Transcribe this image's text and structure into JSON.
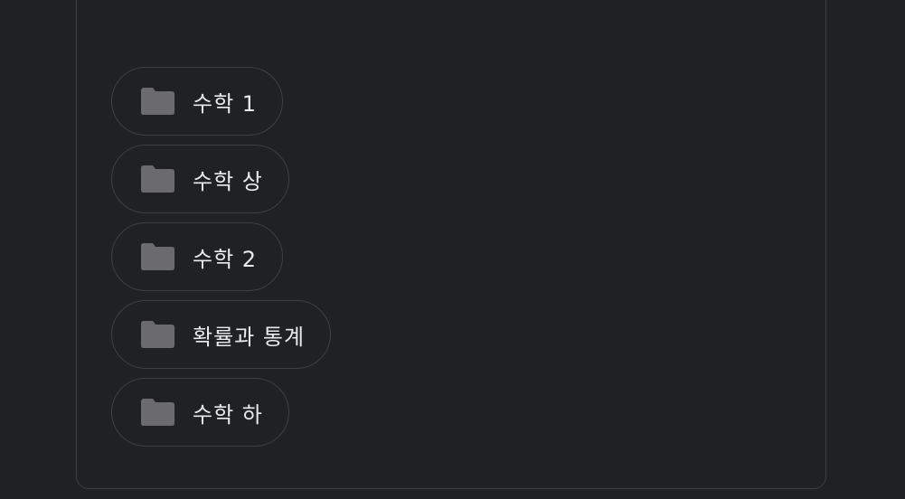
{
  "folders": [
    {
      "label": "수학 1",
      "icon": "folder-icon"
    },
    {
      "label": "수학 상",
      "icon": "folder-icon"
    },
    {
      "label": "수학 2",
      "icon": "folder-icon"
    },
    {
      "label": "확률과 통계",
      "icon": "folder-icon"
    },
    {
      "label": "수학 하",
      "icon": "folder-icon"
    }
  ],
  "colors": {
    "background": "#202124",
    "border": "#3c4043",
    "text": "#e8eaed",
    "folder_icon": "#6b6b6e"
  }
}
